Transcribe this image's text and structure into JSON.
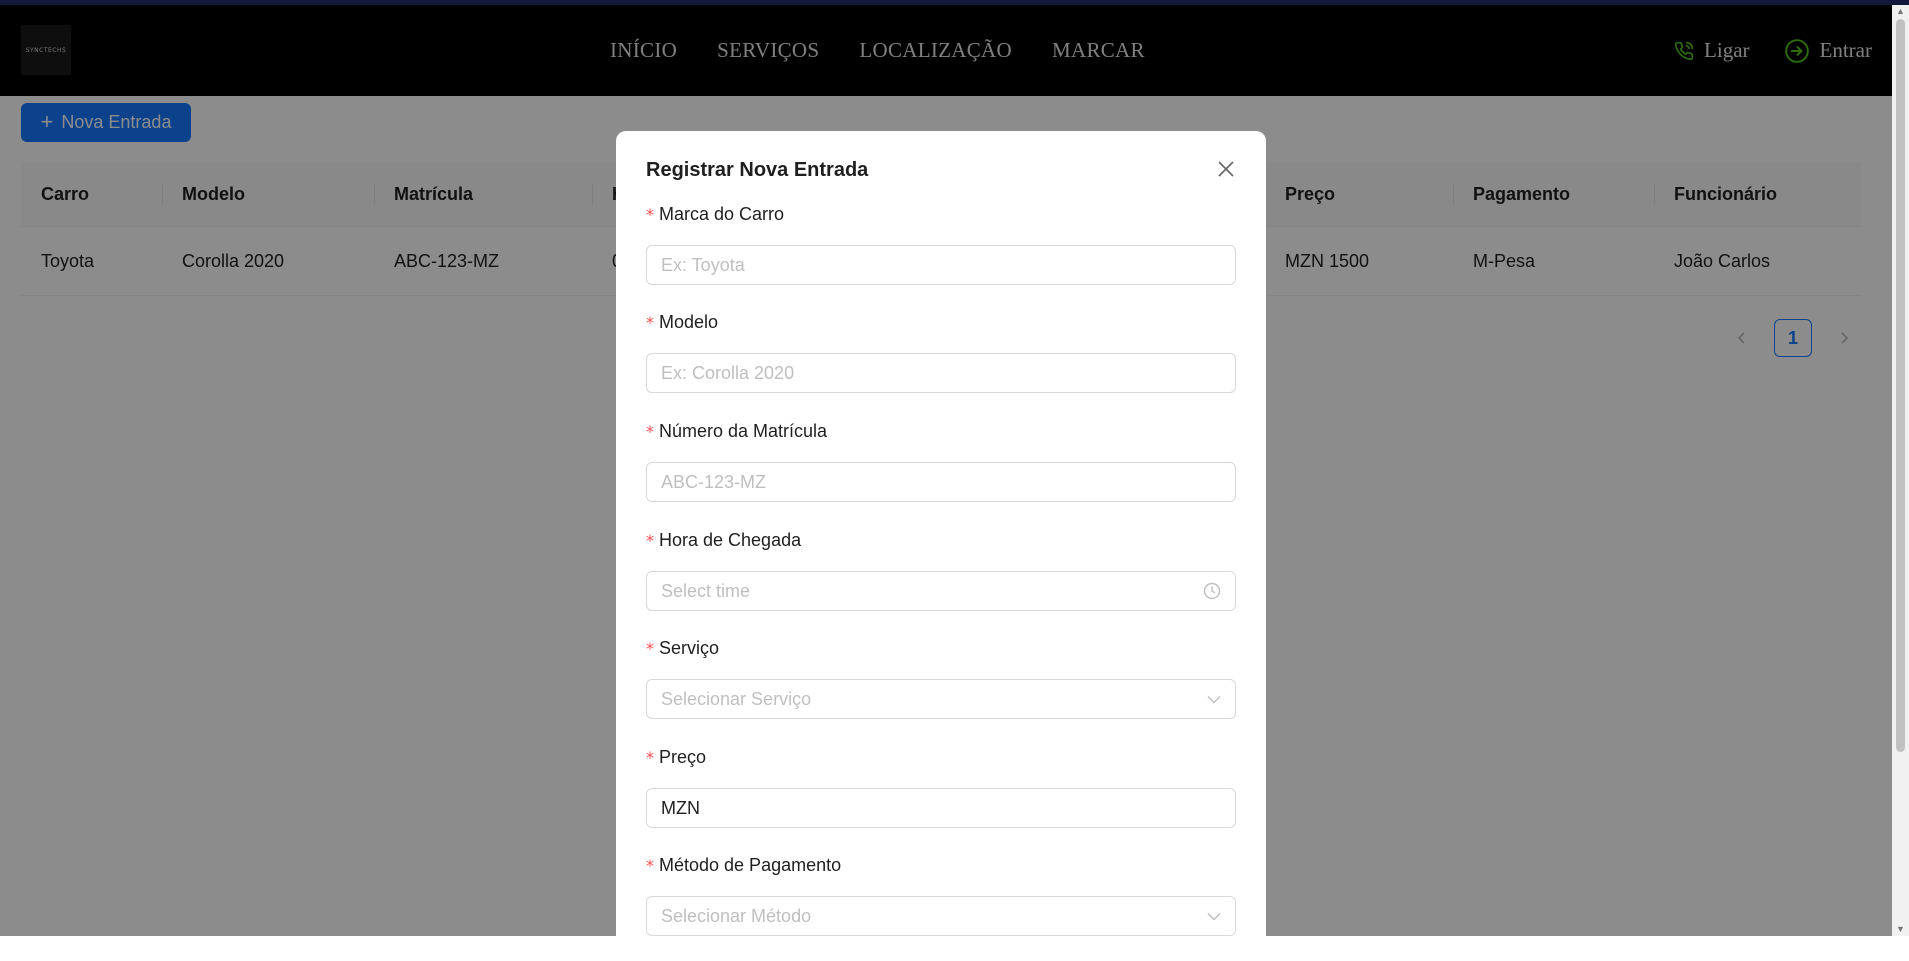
{
  "nav": {
    "logo_text": "SYNCTECHS",
    "links": [
      "INÍCIO",
      "SERVIÇOS",
      "LOCALIZAÇÃO",
      "MARCAR"
    ],
    "call_label": "Ligar",
    "login_label": "Entrar",
    "accent_color": "#52c41a"
  },
  "page": {
    "new_button_label": "Nova Entrada",
    "table": {
      "headers": [
        "Carro",
        "Modelo",
        "Matrícula",
        "H",
        "Preço",
        "Pagamento",
        "Funcionário"
      ],
      "rows": [
        [
          "Toyota",
          "Corolla 2020",
          "ABC-123-MZ",
          "0",
          "MZN 1500",
          "M-Pesa",
          "João Carlos"
        ]
      ]
    },
    "pagination": {
      "current_page": "1"
    }
  },
  "modal": {
    "title": "Registrar Nova Entrada",
    "required_mark": "*",
    "fields": {
      "marca": {
        "label": "Marca do Carro",
        "placeholder": "Ex: Toyota"
      },
      "modelo": {
        "label": "Modelo",
        "placeholder": "Ex: Corolla 2020"
      },
      "matricula": {
        "label": "Número da Matrícula",
        "placeholder": "ABC-123-MZ"
      },
      "hora": {
        "label": "Hora de Chegada",
        "placeholder": "Select time"
      },
      "servico": {
        "label": "Serviço",
        "placeholder": "Selecionar Serviço"
      },
      "preco": {
        "label": "Preço",
        "value": "MZN"
      },
      "pagamento": {
        "label": "Método de Pagamento",
        "placeholder": "Selecionar Método"
      }
    }
  }
}
